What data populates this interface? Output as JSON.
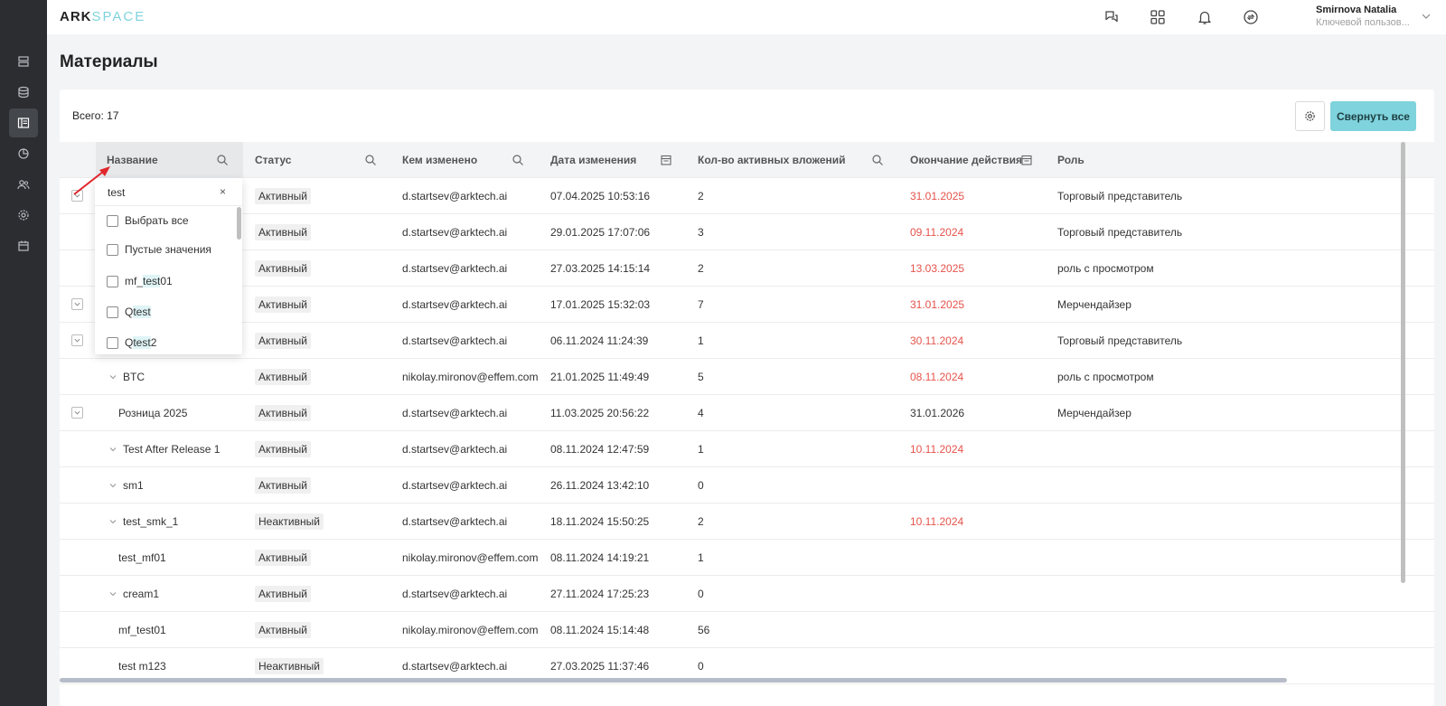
{
  "app": {
    "logo_main": "ARK",
    "logo_accent": "SPACE"
  },
  "sidebar": {
    "items": [
      {
        "icon": "servers-icon"
      },
      {
        "icon": "database-icon"
      },
      {
        "icon": "layout-icon",
        "active": true
      },
      {
        "icon": "pie-chart-icon"
      },
      {
        "icon": "users-icon"
      },
      {
        "icon": "gear-icon"
      },
      {
        "icon": "calendar-icon"
      }
    ]
  },
  "header": {
    "icons": [
      "chat-help-icon",
      "apps-grid-icon",
      "bell-icon",
      "sync-icon"
    ],
    "user_name": "Smirnova Natalia",
    "user_role": "Ключевой пользов..."
  },
  "page": {
    "title": "Материалы",
    "total_label": "Всего: 17",
    "collapse_all_label": "Свернуть все"
  },
  "table": {
    "columns": [
      {
        "label": "Название",
        "icon": "search-icon"
      },
      {
        "label": "Статус",
        "icon": "search-icon"
      },
      {
        "label": "Кем изменено",
        "icon": "search-icon"
      },
      {
        "label": "Дата изменения",
        "icon": "calendar-filter-icon"
      },
      {
        "label": "Кол-во активных вложений",
        "icon": "search-icon"
      },
      {
        "label": "Окончание действия",
        "icon": "calendar-filter-icon"
      },
      {
        "label": "Роль",
        "icon": ""
      }
    ],
    "rows": [
      {
        "name": "",
        "status": "Активный",
        "modified_by": "d.startsev@arktech.ai",
        "modified_at": "07.04.2025 10:53:16",
        "attachments": "2",
        "end_date": "31.01.2025",
        "end_expired": true,
        "role": "Торговый представитель",
        "expander": true,
        "chevron": false
      },
      {
        "name": "",
        "status": "Активный",
        "modified_by": "d.startsev@arktech.ai",
        "modified_at": "29.01.2025 17:07:06",
        "attachments": "3",
        "end_date": "09.11.2024",
        "end_expired": true,
        "role": "Торговый представитель",
        "expander": false,
        "chevron": false
      },
      {
        "name": "",
        "status": "Активный",
        "modified_by": "d.startsev@arktech.ai",
        "modified_at": "27.03.2025 14:15:14",
        "attachments": "2",
        "end_date": "13.03.2025",
        "end_expired": true,
        "role": "роль с просмотром",
        "expander": false,
        "chevron": false
      },
      {
        "name": "",
        "status": "Активный",
        "modified_by": "d.startsev@arktech.ai",
        "modified_at": "17.01.2025 15:32:03",
        "attachments": "7",
        "end_date": "31.01.2025",
        "end_expired": true,
        "role": "Мерчендайзер",
        "expander": true,
        "chevron": false
      },
      {
        "name": "",
        "status": "Активный",
        "modified_by": "d.startsev@arktech.ai",
        "modified_at": "06.11.2024 11:24:39",
        "attachments": "1",
        "end_date": "30.11.2024",
        "end_expired": true,
        "role": "Торговый представитель",
        "expander": true,
        "chevron": false
      },
      {
        "name": "BTC",
        "status": "Активный",
        "modified_by": "nikolay.mironov@effem.com",
        "modified_at": "21.01.2025 11:49:49",
        "attachments": "5",
        "end_date": "08.11.2024",
        "end_expired": true,
        "role": "роль с просмотром",
        "expander": false,
        "chevron": true
      },
      {
        "name": "Розница 2025",
        "status": "Активный",
        "modified_by": "d.startsev@arktech.ai",
        "modified_at": "11.03.2025 20:56:22",
        "attachments": "4",
        "end_date": "31.01.2026",
        "end_expired": false,
        "role": "Мерчендайзер",
        "expander": true,
        "chevron": false
      },
      {
        "name": "Test After Release 1",
        "status": "Активный",
        "modified_by": "d.startsev@arktech.ai",
        "modified_at": "08.11.2024 12:47:59",
        "attachments": "1",
        "end_date": "10.11.2024",
        "end_expired": true,
        "role": "",
        "expander": false,
        "chevron": true
      },
      {
        "name": "sm1",
        "status": "Активный",
        "modified_by": "d.startsev@arktech.ai",
        "modified_at": "26.11.2024 13:42:10",
        "attachments": "0",
        "end_date": "",
        "end_expired": false,
        "role": "",
        "expander": false,
        "chevron": true
      },
      {
        "name": "test_smk_1",
        "status": "Неактивный",
        "modified_by": "d.startsev@arktech.ai",
        "modified_at": "18.11.2024 15:50:25",
        "attachments": "2",
        "end_date": "10.11.2024",
        "end_expired": true,
        "role": "",
        "expander": false,
        "chevron": true
      },
      {
        "name": "test_mf01",
        "status": "Активный",
        "modified_by": "nikolay.mironov@effem.com",
        "modified_at": "08.11.2024 14:19:21",
        "attachments": "1",
        "end_date": "",
        "end_expired": false,
        "role": "",
        "expander": false,
        "chevron": false
      },
      {
        "name": "cream1",
        "status": "Активный",
        "modified_by": "d.startsev@arktech.ai",
        "modified_at": "27.11.2024 17:25:23",
        "attachments": "0",
        "end_date": "",
        "end_expired": false,
        "role": "",
        "expander": false,
        "chevron": true
      },
      {
        "name": "mf_test01",
        "status": "Активный",
        "modified_by": "nikolay.mironov@effem.com",
        "modified_at": "08.11.2024 15:14:48",
        "attachments": "56",
        "end_date": "",
        "end_expired": false,
        "role": "",
        "expander": false,
        "chevron": false
      },
      {
        "name": "test m123",
        "status": "Неактивный",
        "modified_by": "d.startsev@arktech.ai",
        "modified_at": "27.03.2025 11:37:46",
        "attachments": "0",
        "end_date": "",
        "end_expired": false,
        "role": "",
        "expander": false,
        "chevron": false
      }
    ]
  },
  "filter_dropdown": {
    "search_value": "test",
    "clear_label": "×",
    "options": [
      {
        "parts": [
          {
            "text": "Выбрать все",
            "hl": false
          }
        ]
      },
      {
        "parts": [
          {
            "text": "Пустые значения",
            "hl": false
          }
        ]
      },
      {
        "parts": [
          {
            "text": "mf_",
            "hl": false
          },
          {
            "text": "test",
            "hl": true
          },
          {
            "text": "01",
            "hl": false
          }
        ]
      },
      {
        "parts": [
          {
            "text": "Q ",
            "hl": false
          },
          {
            "text": "test",
            "hl": true
          }
        ]
      },
      {
        "parts": [
          {
            "text": "Q ",
            "hl": false
          },
          {
            "text": "test",
            "hl": true
          },
          {
            "text": " 2",
            "hl": false
          }
        ]
      }
    ]
  },
  "colors": {
    "accent": "#7fd3dc",
    "sidebar_bg": "#2b2d30",
    "expired_date": "#e5534b",
    "annotation_arrow": "#e0262b"
  }
}
